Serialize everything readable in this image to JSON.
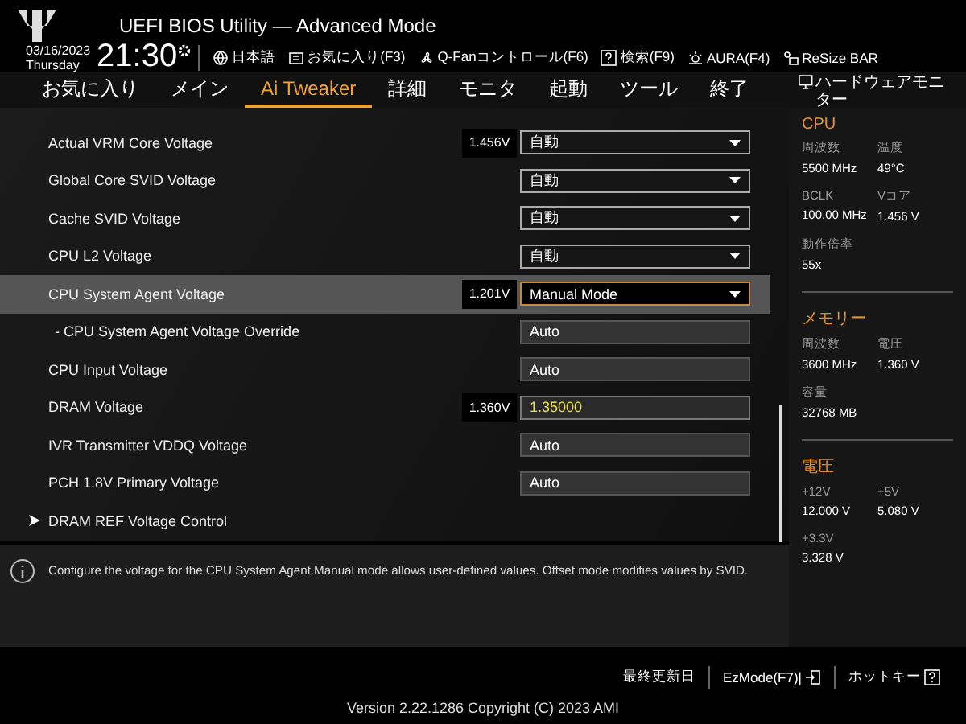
{
  "header": {
    "title": "UEFI BIOS Utility — Advanced Mode",
    "date": "03/16/2023",
    "weekday": "Thursday",
    "time": "21:30",
    "toolbar": [
      {
        "kind": "globe",
        "label": "日本語"
      },
      {
        "kind": "star",
        "label": "お気に入り(F3)"
      },
      {
        "kind": "fan",
        "label": "Q-Fanコントロール(F6)"
      },
      {
        "kind": "help",
        "label": "検索(F9)"
      },
      {
        "kind": "light",
        "label": "AURA(F4)"
      },
      {
        "kind": "bar",
        "label": "ReSize BAR"
      }
    ]
  },
  "tabs": [
    {
      "label": "お気に入り",
      "selected": false
    },
    {
      "label": "メイン",
      "selected": false
    },
    {
      "label": "Ai Tweaker",
      "selected": true
    },
    {
      "label": "詳細",
      "selected": false
    },
    {
      "label": "モニタ",
      "selected": false
    },
    {
      "label": "起動",
      "selected": false
    },
    {
      "label": "ツール",
      "selected": false
    },
    {
      "label": "終了",
      "selected": false
    }
  ],
  "settings": [
    {
      "kind": "dropdown",
      "label": "Actual VRM Core Voltage",
      "reading": "1.456V",
      "value": "自動",
      "selected": false
    },
    {
      "kind": "dropdown",
      "label": "Global Core SVID Voltage",
      "value": "自動",
      "selected": false
    },
    {
      "kind": "dropdown",
      "label": "Cache SVID Voltage",
      "value": "自動",
      "selected": false
    },
    {
      "kind": "dropdown",
      "label": "CPU L2 Voltage",
      "value": "自動",
      "selected": false
    },
    {
      "kind": "dropdown",
      "label": "CPU System Agent Voltage",
      "reading": "1.201V",
      "value": "Manual Mode",
      "selected": true
    },
    {
      "kind": "field",
      "label": "- CPU System Agent Voltage Override",
      "value": "Auto",
      "selected": false,
      "changed": false,
      "sub": true
    },
    {
      "kind": "field",
      "label": "CPU Input Voltage",
      "value": "Auto",
      "selected": false,
      "changed": false
    },
    {
      "kind": "field",
      "label": "DRAM Voltage",
      "reading": "1.360V",
      "value": "1.35000",
      "selected": false,
      "changed": true
    },
    {
      "kind": "field",
      "label": "IVR Transmitter VDDQ Voltage",
      "value": "Auto",
      "selected": false,
      "changed": false
    },
    {
      "kind": "field",
      "label": "PCH 1.8V Primary Voltage",
      "value": "Auto",
      "selected": false,
      "changed": false
    },
    {
      "kind": "submenu",
      "label": "DRAM REF Voltage Control",
      "selected": false
    }
  ],
  "help": "Configure the voltage for the CPU System Agent.Manual mode allows user-defined values. Offset mode modifies values by SVID.",
  "monitor": {
    "title": "ハードウェアモニター",
    "sections": [
      {
        "title": "CPU",
        "items": [
          {
            "label": "周波数",
            "value": "5500 MHz"
          },
          {
            "label": "温度",
            "value": "49°C"
          },
          {
            "label": "BCLK",
            "value": "100.00 MHz"
          },
          {
            "label": "Vコア",
            "value": "1.456 V"
          },
          {
            "label": "動作倍率",
            "value": "55x"
          }
        ]
      },
      {
        "title": "メモリー",
        "items": [
          {
            "label": "周波数",
            "value": "3600 MHz"
          },
          {
            "label": "電圧",
            "value": "1.360 V"
          },
          {
            "label": "容量",
            "value": "32768 MB"
          }
        ]
      },
      {
        "title": "電圧",
        "items": [
          {
            "label": "+12V",
            "value": "12.000 V"
          },
          {
            "label": "+5V",
            "value": "5.080 V"
          },
          {
            "label": "+3.3V",
            "value": "3.328 V"
          }
        ]
      }
    ]
  },
  "footer": {
    "buttons": [
      {
        "kind": "text",
        "label": "最終更新日"
      },
      {
        "kind": "exit",
        "label": "EzMode(F7)|"
      },
      {
        "kind": "help",
        "label": "ホットキー"
      }
    ],
    "version": "Version 2.22.1286 Copyright (C) 2023 AMI"
  }
}
